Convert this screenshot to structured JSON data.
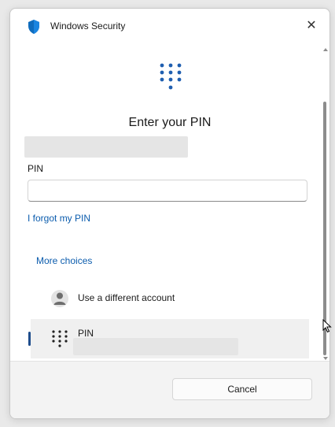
{
  "window": {
    "title": "Windows Security",
    "close_icon": "close-icon",
    "brand_icon": "shield-icon"
  },
  "main": {
    "heading": "Enter your PIN",
    "pin_label": "PIN",
    "pin_value": "",
    "forgot_link": "I forgot my PIN",
    "more_choices": "More choices",
    "keypad_icon": "keypad-icon"
  },
  "options": [
    {
      "label": "Use a different account",
      "icon": "person-icon",
      "selected": false
    },
    {
      "label": "PIN",
      "icon": "keypad-icon",
      "selected": true
    }
  ],
  "footer": {
    "cancel_label": "Cancel"
  },
  "colors": {
    "accent": "#1f4d8c",
    "link": "#0b5cad",
    "shield": "#0f6cbd"
  }
}
